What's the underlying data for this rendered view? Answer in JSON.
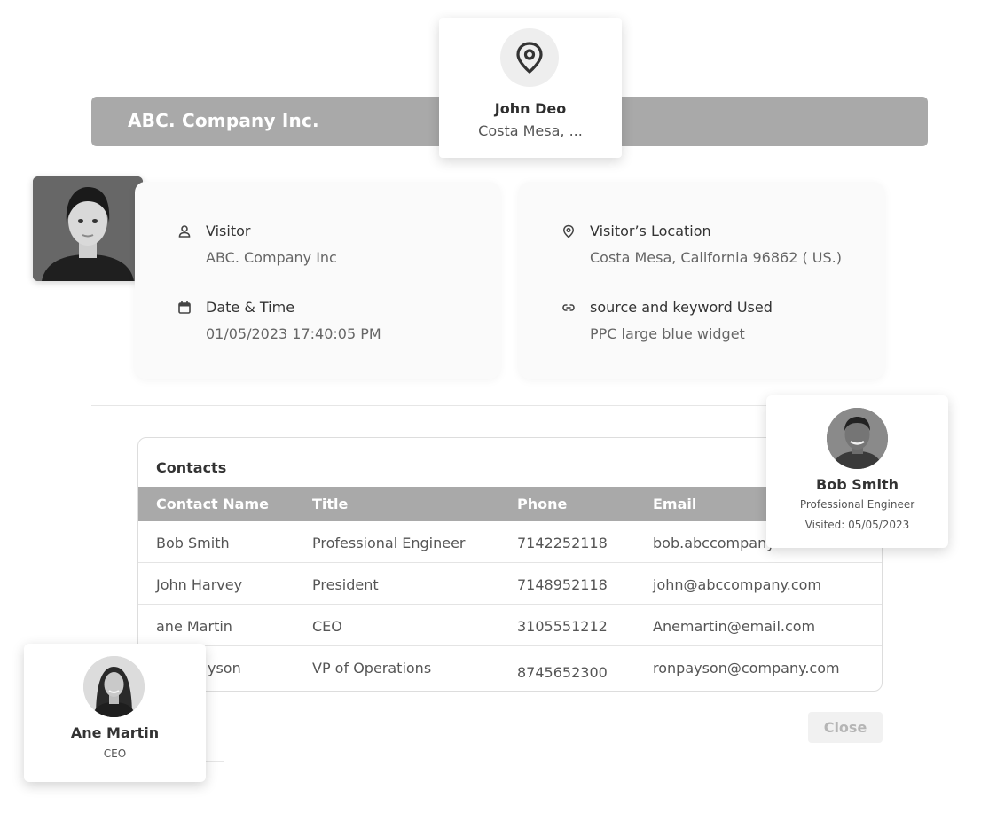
{
  "header": {
    "company_title": "ABC. Company Inc."
  },
  "location_card": {
    "icon": "map-pin-icon",
    "name": "John Deo",
    "subtitle": "Costa Mesa, ..."
  },
  "visitor_photo": {
    "icon": "person-portrait"
  },
  "visit_info": {
    "visitor": {
      "icon": "user-icon",
      "label": "Visitor",
      "value": "ABC. Company Inc"
    },
    "date_time": {
      "icon": "calendar-icon",
      "label": "Date & Time",
      "value": "01/05/2023 17:40:05 PM"
    },
    "location": {
      "icon": "map-pin-icon",
      "label": "Visitor’s Location",
      "value": "Costa Mesa, California 96862 ( US.)"
    },
    "source": {
      "icon": "link-icon",
      "label": "source and keyword Used",
      "value": "PPC large blue widget"
    }
  },
  "contacts": {
    "title": "Contacts",
    "columns": [
      "Contact Name",
      "Title",
      "Phone",
      "Email"
    ],
    "rows": [
      {
        "name": "Bob Smith",
        "title": "Professional Engineer",
        "phone": "7142252118",
        "email": "bob.abccompany.com"
      },
      {
        "name": "John Harvey",
        "title": "President",
        "phone": "7148952118",
        "email": "john@abccompany.com"
      },
      {
        "name": "ane Martin",
        "title": "CEO",
        "phone": "3105551212",
        "email": "Anemartin@email.com"
      },
      {
        "name": "yson",
        "title": "VP of Operations",
        "phone": "8745652300",
        "email": "ronpayson@company.com"
      }
    ]
  },
  "close_button": {
    "label": "Close"
  },
  "bob_card": {
    "name": "Bob Smith",
    "title": "Professional Engineer",
    "visited": "Visited: 05/05/2023"
  },
  "ane_card": {
    "name": "Ane Martin",
    "title": "CEO"
  },
  "colors": {
    "header_bg": "#a9a9a9",
    "table_header_bg": "#a9a9a9",
    "card_bg": "#fafafa"
  }
}
